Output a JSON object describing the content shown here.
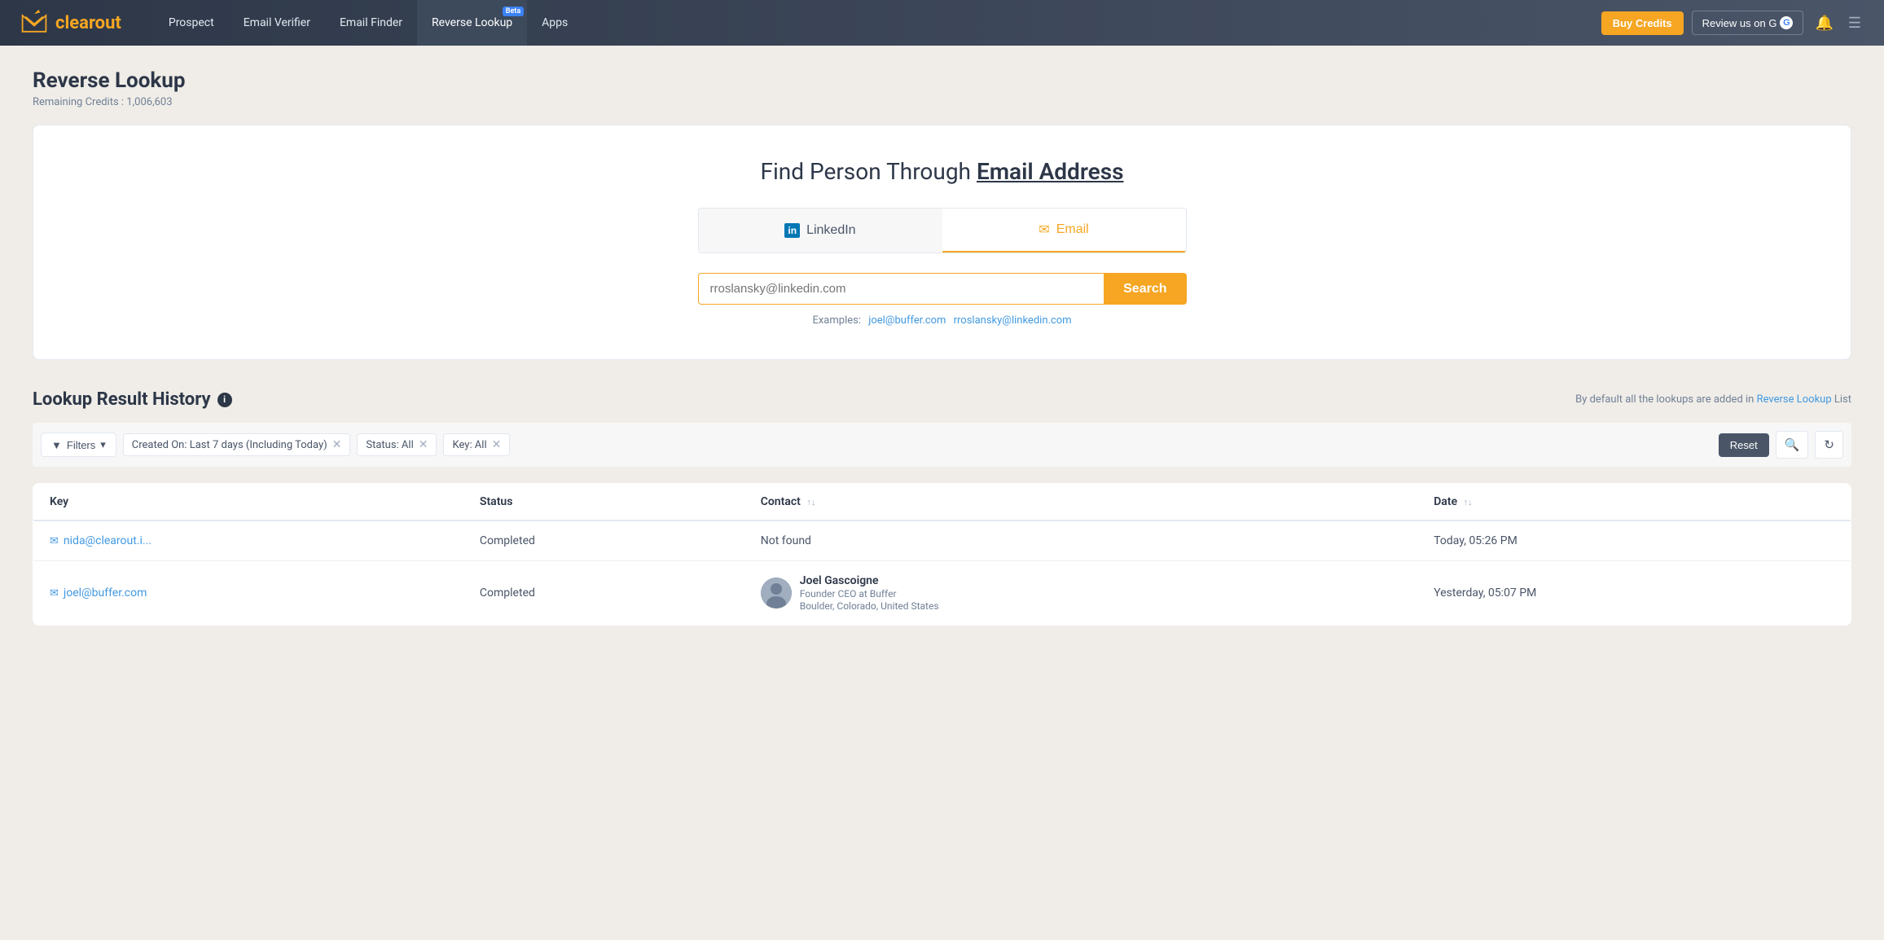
{
  "app": {
    "name_clear": "clear",
    "name_out": "out",
    "logo_unicode": "✉"
  },
  "navbar": {
    "links": [
      {
        "label": "Prospect",
        "active": false
      },
      {
        "label": "Email Verifier",
        "active": false
      },
      {
        "label": "Email Finder",
        "active": false
      },
      {
        "label": "Reverse Lookup",
        "active": true,
        "beta": true
      },
      {
        "label": "Apps",
        "active": false
      }
    ],
    "buy_credits_label": "Buy Credits",
    "review_label": "Review us on G"
  },
  "page": {
    "title": "Reverse Lookup",
    "subtitle_prefix": "Remaining Credits : ",
    "credits": "1,006,603"
  },
  "search_card": {
    "heading": "Find Person Through Email Address",
    "heading_underline": "Email Address",
    "tabs": [
      {
        "label": "LinkedIn",
        "icon": "in",
        "active": false
      },
      {
        "label": "Email",
        "icon": "✉",
        "active": true
      }
    ],
    "input_placeholder": "rroslansky@linkedin.com",
    "search_button": "Search",
    "examples_label": "Examples:",
    "example1": "joel@buffer.com",
    "example2": "rroslansky@linkedin.com"
  },
  "history": {
    "title": "Lookup Result History",
    "note_prefix": "By default all the lookups are added in ",
    "note_link": "Reverse Lookup",
    "note_suffix": " List",
    "filters": {
      "filter_btn": "Filters",
      "filter1": "Created On: Last 7 days (Including Today)",
      "filter2": "Status: All",
      "filter3": "Key: All",
      "reset_btn": "Reset"
    },
    "columns": [
      {
        "label": "Key",
        "sortable": false
      },
      {
        "label": "Status",
        "sortable": false
      },
      {
        "label": "Contact",
        "sortable": true
      },
      {
        "label": "Date",
        "sortable": true
      }
    ],
    "rows": [
      {
        "key": "nida@clearout.i...",
        "key_icon": "✉",
        "status": "Completed",
        "contact": "Not found",
        "contact_type": "text",
        "date": "Today, 05:26 PM"
      },
      {
        "key": "joel@buffer.com",
        "key_icon": "✉",
        "status": "Completed",
        "contact_type": "person",
        "contact_name": "Joel Gascoigne",
        "contact_title": "Founder CEO at Buffer",
        "contact_location": "Boulder, Colorado, United States",
        "date": "Yesterday, 05:07 PM"
      }
    ]
  }
}
